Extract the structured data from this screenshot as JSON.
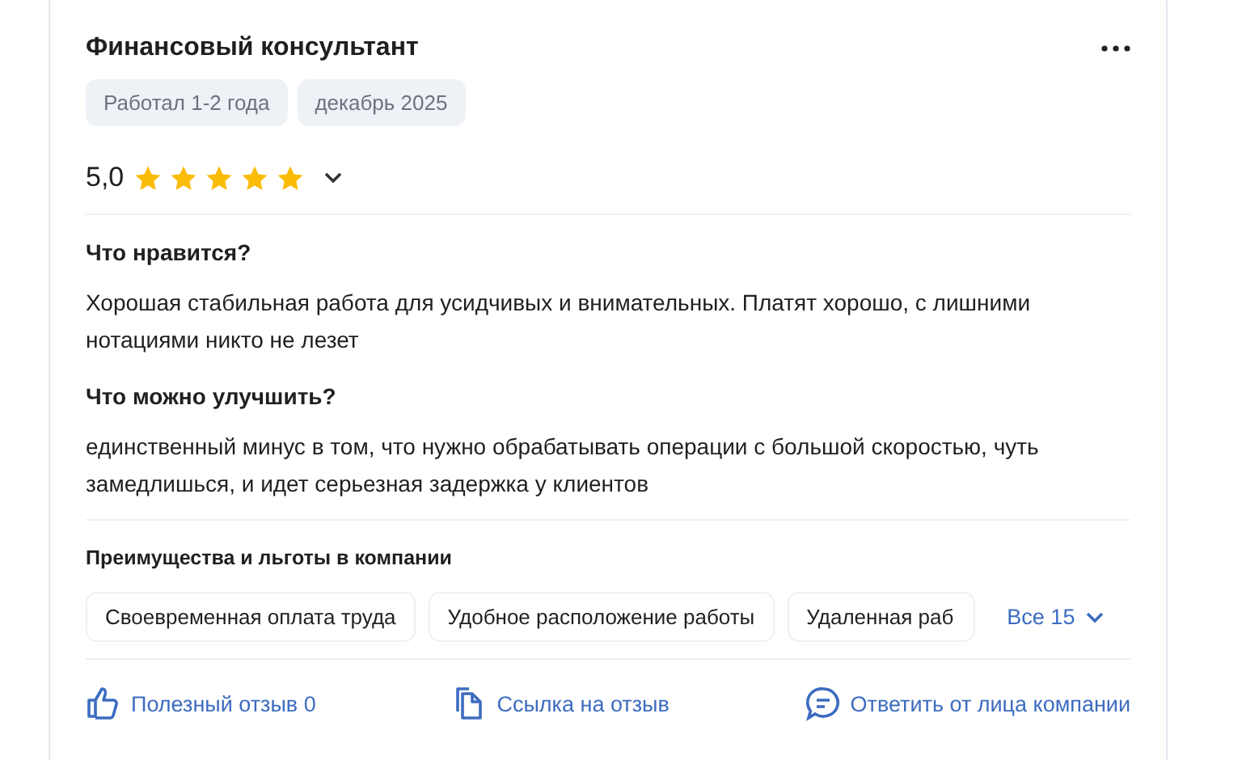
{
  "review": {
    "title": "Финансовый консультант",
    "tags": [
      "Работал 1-2 года",
      "декабрь 2025"
    ],
    "rating": "5,0",
    "stars": 5,
    "sections": [
      {
        "heading": "Что нравится?",
        "text": "Хорошая стабильная работа для усидчивых и внимательных. Платят хорошо, с лишними нотациями никто не лезет"
      },
      {
        "heading": "Что можно улучшить?",
        "text": "единственный минус в том, что нужно обрабатывать операции с большой скоростью, чуть замедлишься, и идет серьезная задержка у клиентов"
      }
    ],
    "benefits": {
      "heading": "Преимущества и льготы в компании",
      "items": [
        "Своевременная оплата труда",
        "Удобное расположение работы",
        "Удаленная раб"
      ],
      "more": "Все 15"
    },
    "actions": [
      {
        "kind": "like",
        "label": "Полезный отзыв 0"
      },
      {
        "kind": "link",
        "label": "Ссылка на отзыв"
      },
      {
        "kind": "reply",
        "label": "Ответить от лица компании"
      }
    ]
  }
}
